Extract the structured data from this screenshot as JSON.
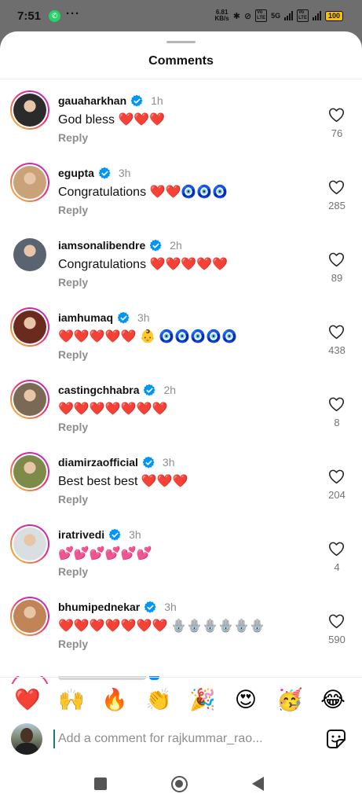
{
  "status_bar": {
    "time": "7:51",
    "whatsapp_icon": "whatsapp-icon",
    "more": "···",
    "net_speed_value": "6.81",
    "net_speed_unit": "KB/s",
    "network": "5G",
    "battery": "100"
  },
  "header": {
    "title": "Comments"
  },
  "comments": [
    {
      "username": "gauaharkhan",
      "time": "1h",
      "text": "God bless ❤️❤️❤️",
      "reply": "Reply",
      "likes": "76",
      "avatar_color": "#2b2b2b",
      "ring": true
    },
    {
      "username": "egupta",
      "time": "3h",
      "text": "Congratulations ❤️❤️🧿🧿🧿",
      "reply": "Reply",
      "likes": "285",
      "avatar_color": "#c9a27a",
      "ring": true
    },
    {
      "username": "iamsonalibendre",
      "time": "2h",
      "text": "Congratulations ❤️❤️❤️❤️❤️",
      "reply": "Reply",
      "likes": "89",
      "avatar_color": "#5a6470",
      "ring": false
    },
    {
      "username": "iamhumaq",
      "time": "3h",
      "text": "❤️❤️❤️❤️❤️ 👶 🧿🧿🧿🧿🧿",
      "reply": "Reply",
      "likes": "438",
      "avatar_color": "#6b2a1e",
      "ring": true
    },
    {
      "username": "castingchhabra",
      "time": "2h",
      "text": "❤️❤️❤️❤️❤️❤️❤️",
      "reply": "Reply",
      "likes": "8",
      "avatar_color": "#7a6a55",
      "ring": true
    },
    {
      "username": "diamirzaofficial",
      "time": "3h",
      "text": "Best best best ❤️❤️❤️",
      "reply": "Reply",
      "likes": "204",
      "avatar_color": "#7d8a4a",
      "ring": true
    },
    {
      "username": "iratrivedi",
      "time": "3h",
      "text": "💕💕💕💕💕💕",
      "reply": "Reply",
      "likes": "4",
      "avatar_color": "#d9dfe0",
      "ring": true
    },
    {
      "username": "bhumipednekar",
      "time": "3h",
      "text": "❤️❤️❤️❤️❤️❤️❤️ 🪬🪬🪬🪬🪬🪬",
      "reply": "Reply",
      "likes": "590",
      "avatar_color": "#c08457",
      "ring": true
    }
  ],
  "quick_emojis": [
    "❤️",
    "🙌",
    "🔥",
    "👏",
    "🎉",
    "😍",
    "🥳",
    "😂"
  ],
  "composer": {
    "placeholder": "Add a comment for rajkummar_rao..."
  },
  "colors": {
    "accent": "#0095f6",
    "verified": "#0095f6",
    "secondary_text": "#8e8e8e"
  }
}
